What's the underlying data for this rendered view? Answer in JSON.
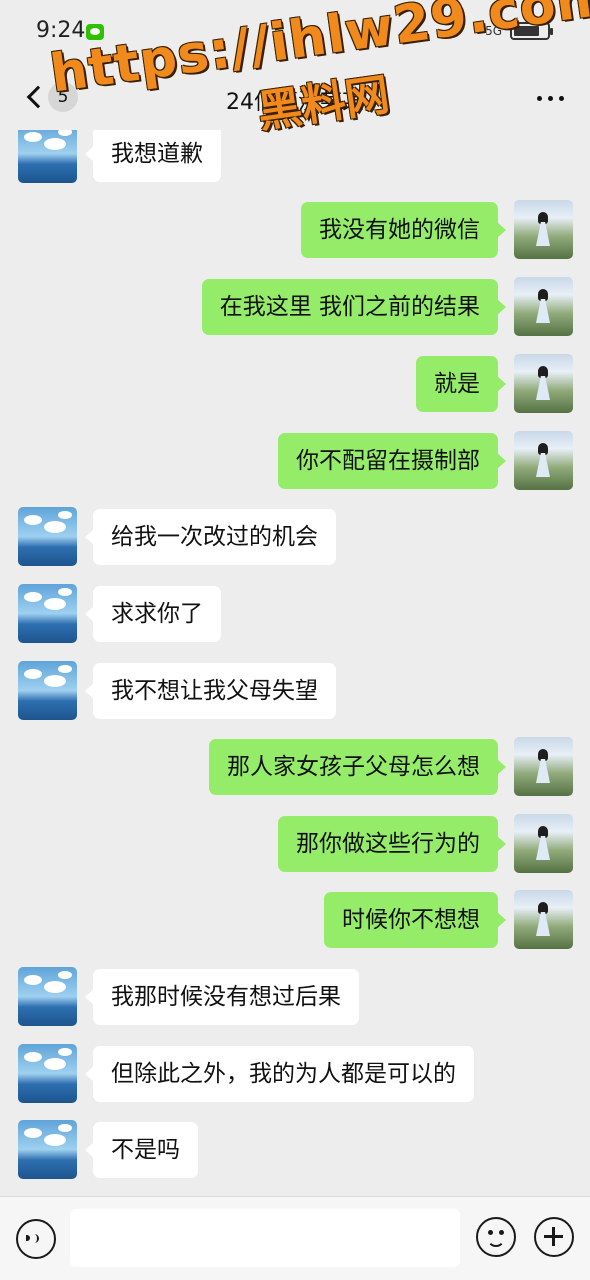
{
  "status_bar": {
    "time": "9:24",
    "network": "5G"
  },
  "nav": {
    "back_badge": "5",
    "title": "24信管沈某某"
  },
  "watermark": {
    "url": "https://ihlw29.com",
    "site": "黑料网"
  },
  "messages": [
    {
      "side": "left",
      "text": "我想道歉"
    },
    {
      "side": "right",
      "text": "我没有她的微信"
    },
    {
      "side": "right",
      "text": "在我这里 我们之前的结果"
    },
    {
      "side": "right",
      "text": "就是"
    },
    {
      "side": "right",
      "text": "你不配留在摄制部"
    },
    {
      "side": "left",
      "text": "给我一次改过的机会"
    },
    {
      "side": "left",
      "text": "求求你了"
    },
    {
      "side": "left",
      "text": "我不想让我父母失望"
    },
    {
      "side": "right",
      "text": "那人家女孩子父母怎么想"
    },
    {
      "side": "right",
      "text": "那你做这些行为的"
    },
    {
      "side": "right",
      "text": "时候你不想想"
    },
    {
      "side": "left",
      "text": "我那时候没有想过后果"
    },
    {
      "side": "left",
      "text": "但除此之外，我的为人都是可以的"
    },
    {
      "side": "left",
      "text": "不是吗"
    }
  ],
  "input": {
    "value": "",
    "placeholder": ""
  },
  "colors": {
    "background": "#ededed",
    "bubble_self": "#95ec69",
    "bubble_other": "#ffffff",
    "watermark": "#f08a1c"
  }
}
